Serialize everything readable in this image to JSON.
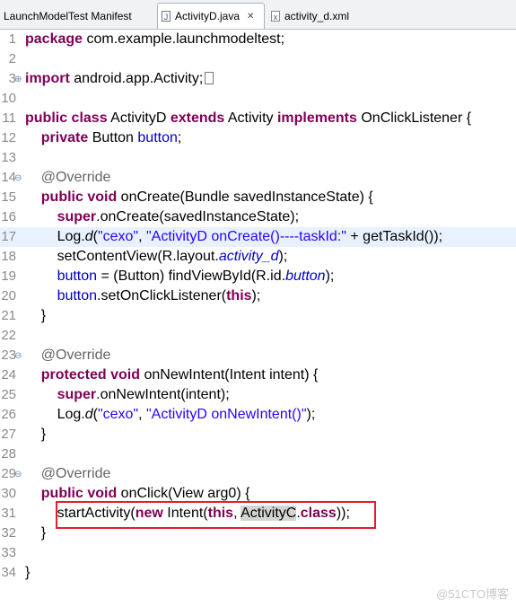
{
  "tabs": [
    {
      "label": "LaunchModelTest Manifest"
    },
    {
      "label": "ActivityD.java"
    },
    {
      "label": "activity_d.xml"
    }
  ],
  "lines": {
    "l1": {
      "n": "1",
      "t1": "package",
      "t2": " com.example.launchmodeltest;"
    },
    "l2": {
      "n": "2"
    },
    "l3": {
      "n": "3",
      "t1": "import",
      "t2": " android.app.Activity;"
    },
    "l10": {
      "n": "10"
    },
    "l11": {
      "n": "11",
      "t1": "public class",
      "t2": " ActivityD ",
      "t3": "extends",
      "t4": " Activity ",
      "t5": "implements",
      "t6": " OnClickListener {"
    },
    "l12": {
      "n": "12",
      "t1": "private",
      "t2": " Button ",
      "t3": "button",
      "t4": ";"
    },
    "l13": {
      "n": "13"
    },
    "l14": {
      "n": "14",
      "t1": "@Override"
    },
    "l15": {
      "n": "15",
      "t1": "public void",
      "t2": " onCreate(Bundle savedInstanceState) {"
    },
    "l16": {
      "n": "16",
      "t1": "super",
      "t2": ".onCreate(savedInstanceState);"
    },
    "l17": {
      "n": "17",
      "t1": "Log.",
      "t2": "d",
      "t3": "(",
      "t4": "\"cexo\"",
      "t5": ", ",
      "t6": "\"ActivityD onCreate()----taskId:\"",
      "t7": " + getTaskId());"
    },
    "l18": {
      "n": "18",
      "t1": "setContentView(R.layout.",
      "t2": "activity_d",
      "t3": ");"
    },
    "l19": {
      "n": "19",
      "t1": "button",
      "t2": " = (Button) findViewById(R.id.",
      "t3": "button",
      "t4": ");"
    },
    "l20": {
      "n": "20",
      "t1": "button",
      "t2": ".setOnClickListener(",
      "t3": "this",
      "t4": ");"
    },
    "l21": {
      "n": "21",
      "t1": "}"
    },
    "l22": {
      "n": "22"
    },
    "l23": {
      "n": "23",
      "t1": "@Override"
    },
    "l24": {
      "n": "24",
      "t1": "protected void",
      "t2": " onNewIntent(Intent intent) {"
    },
    "l25": {
      "n": "25",
      "t1": "super",
      "t2": ".onNewIntent(intent);"
    },
    "l26": {
      "n": "26",
      "t1": "Log.",
      "t2": "d",
      "t3": "(",
      "t4": "\"cexo\"",
      "t5": ", ",
      "t6": "\"ActivityD onNewIntent()\"",
      "t7": ");"
    },
    "l27": {
      "n": "27",
      "t1": "}"
    },
    "l28": {
      "n": "28"
    },
    "l29": {
      "n": "29",
      "t1": "@Override"
    },
    "l30": {
      "n": "30",
      "t1": "public void",
      "t2": " onClick(View arg0) {"
    },
    "l31": {
      "n": "31",
      "t1": "startActivity(",
      "t2": "new",
      "t3": " Intent(",
      "t4": "this",
      "t5": ", ",
      "t6": "ActivityC",
      "t7": ".",
      "t8": "class",
      "t9": "));"
    },
    "l32": {
      "n": "32",
      "t1": "}"
    },
    "l33": {
      "n": "33"
    },
    "l34": {
      "n": "34",
      "t1": "}"
    }
  },
  "fold_expand_icon": "plus-icon",
  "fold_collapse_icon": "minus-icon",
  "watermark": "@51CTO博客"
}
